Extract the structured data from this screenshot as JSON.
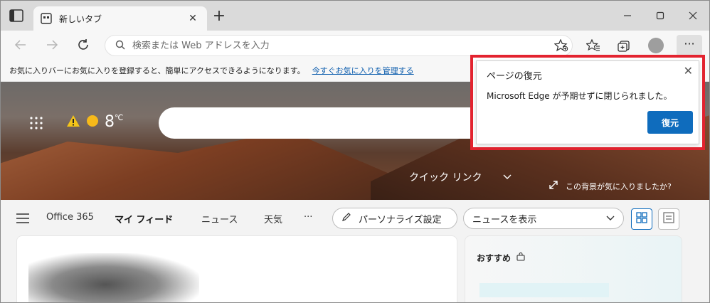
{
  "tab": {
    "title": "新しいタブ",
    "close": "✕",
    "new_tab": "+"
  },
  "window_controls": {
    "minimize": "—",
    "maximize": "▢",
    "close": "✕"
  },
  "address_bar": {
    "placeholder": "検索または Web アドレスを入力",
    "value": ""
  },
  "toolbar": {
    "more": "···"
  },
  "favorites_bar": {
    "message": "お気に入りバーにお気に入りを登録すると、簡単にアクセスできるようになります。",
    "link": "今すぐお気に入りを管理する"
  },
  "hero": {
    "temperature": "8",
    "temperature_unit": "℃",
    "quick_links": "クイック リンク",
    "background_question": "この背景が気に入りましたか?"
  },
  "feed_nav": {
    "items": [
      "Office 365",
      "マイ フィード",
      "ニュース",
      "天気",
      "···"
    ],
    "personalize": "パーソナライズ設定",
    "news_select": "ニュースを表示"
  },
  "side_card": {
    "title": "おすすめ"
  },
  "restore_popup": {
    "title": "ページの復元",
    "message": "Microsoft Edge が予期せずに閉じられました。",
    "button": "復元",
    "close": "✕"
  },
  "colors": {
    "accent": "#0f6cbd",
    "highlight_frame": "#e3232f"
  }
}
